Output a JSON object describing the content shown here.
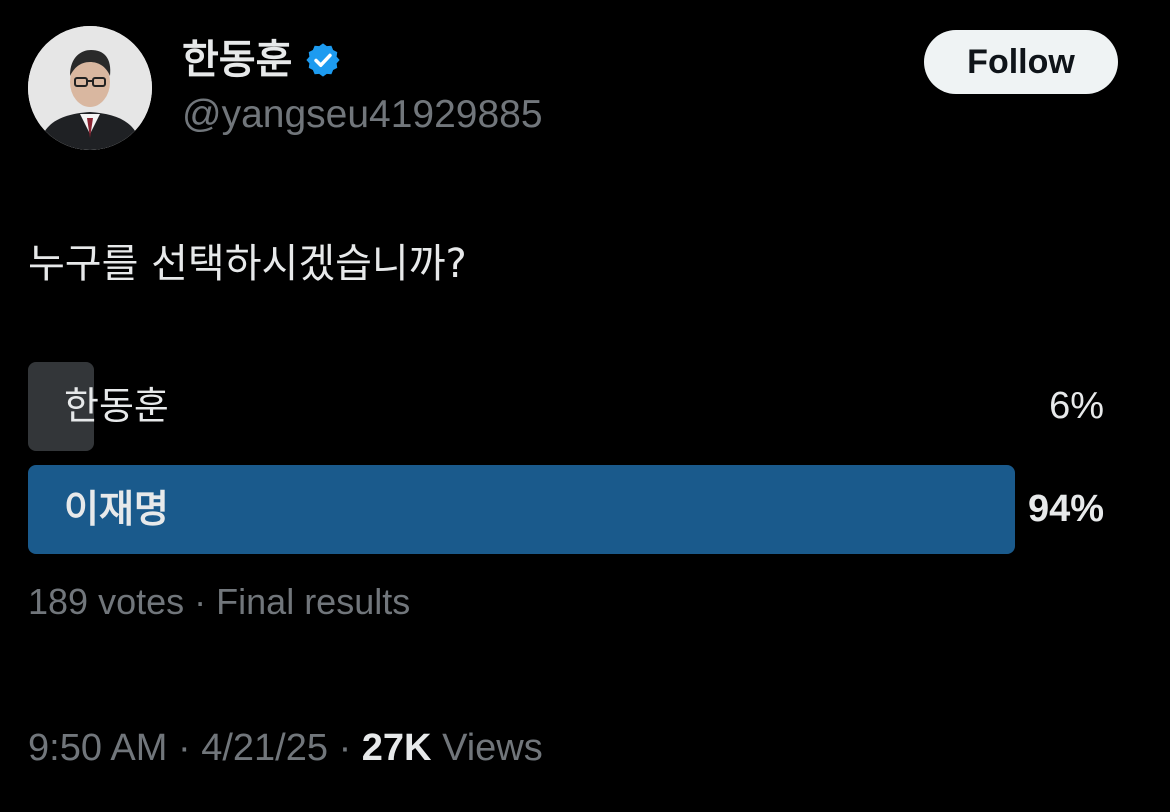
{
  "author": {
    "display_name": "한동훈",
    "handle": "@yangseu41929885",
    "verified": true,
    "avatar_icon": "profile-photo"
  },
  "follow_label": "Follow",
  "post_text": "누구를 선택하시겠습니까?",
  "poll": {
    "options": [
      {
        "label": "한동훈",
        "percent_text": "6%",
        "fraction": 0.06
      },
      {
        "label": "이재명",
        "percent_text": "94%",
        "fraction": 0.94
      }
    ],
    "votes": "189 votes",
    "separator": "·",
    "status": "Final results"
  },
  "meta": {
    "time": "9:50 AM",
    "date": "4/21/25",
    "views_count": "27K",
    "views_label": "Views",
    "separator": "·"
  },
  "colors": {
    "background": "#000000",
    "text_primary": "#e7e9ea",
    "text_secondary": "#71767b",
    "verified_blue": "#1d9bf0",
    "winner_bar": "#1a5a8c",
    "loser_bar": "#333639",
    "follow_bg": "#eff3f4"
  }
}
